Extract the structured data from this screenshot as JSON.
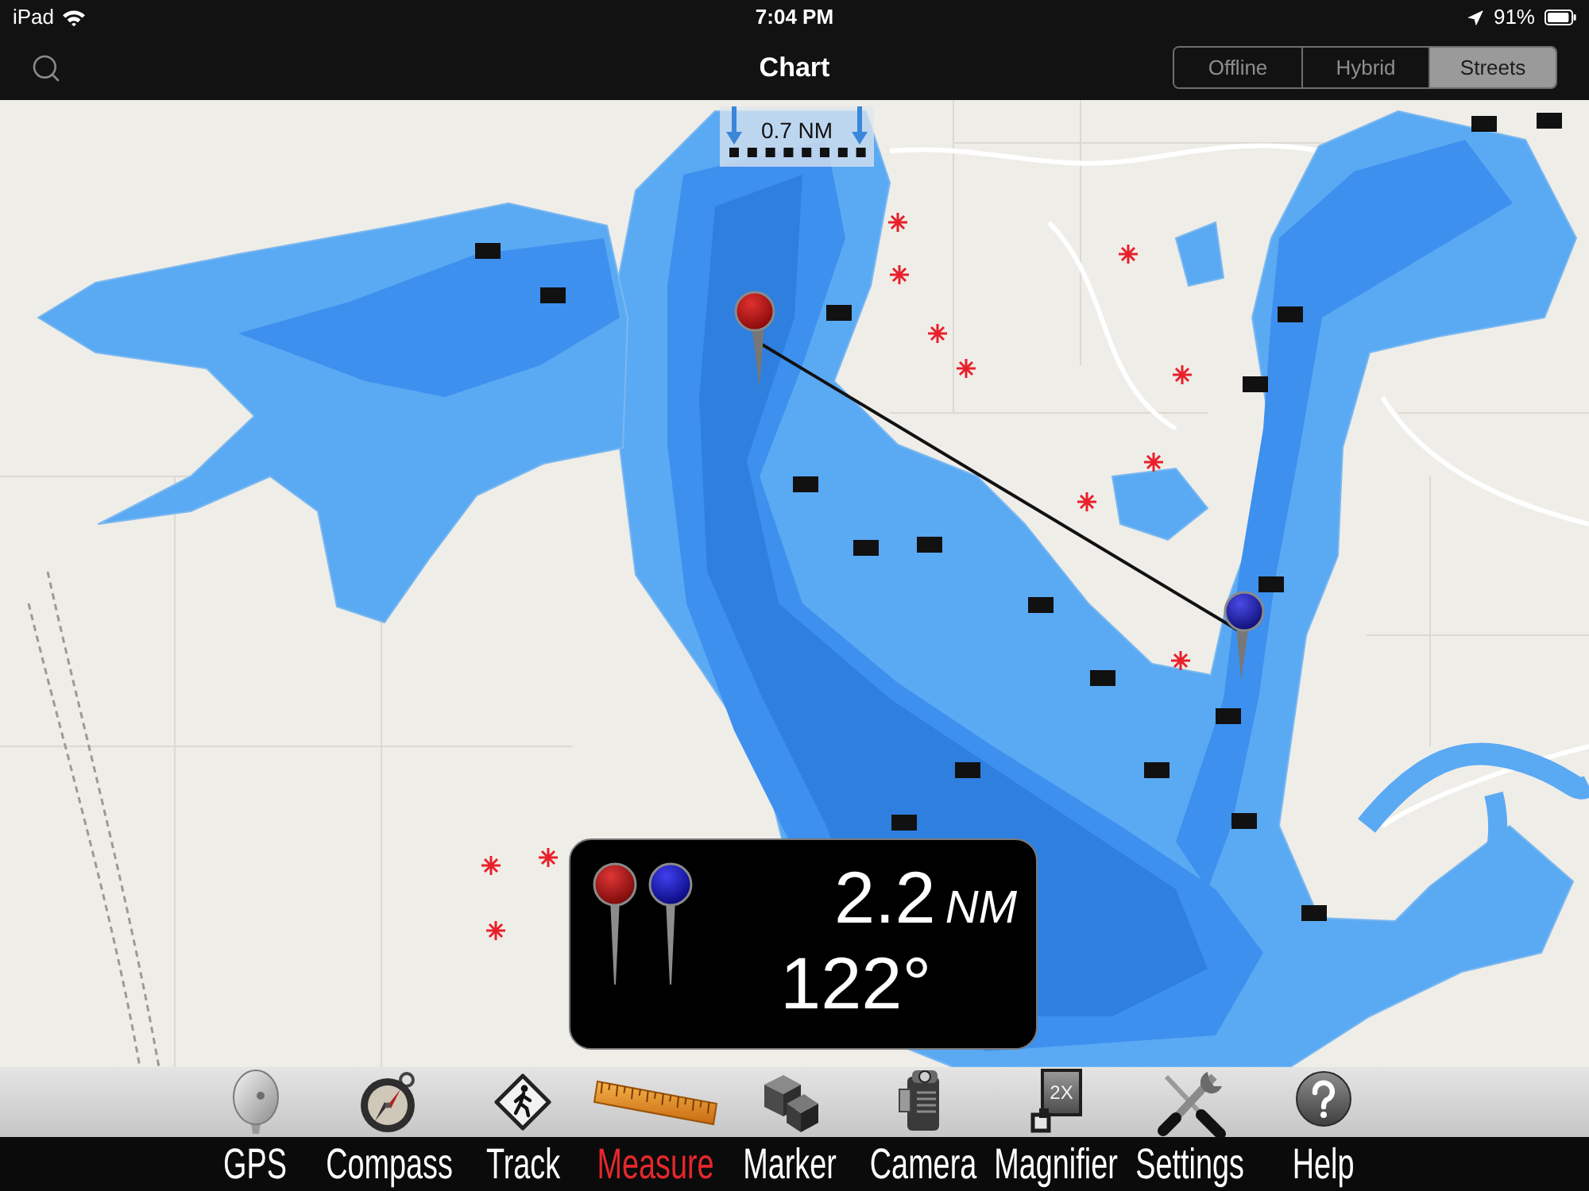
{
  "status_bar": {
    "device": "iPad",
    "time": "7:04 PM",
    "battery": "91%"
  },
  "nav_bar": {
    "title": "Chart",
    "map_modes": [
      {
        "label": "Offline",
        "selected": false
      },
      {
        "label": "Hybrid",
        "selected": false
      },
      {
        "label": "Streets",
        "selected": true
      }
    ]
  },
  "map": {
    "scale": "0.7 NM",
    "measurement": {
      "distance": "2.2",
      "unit": "NM",
      "bearing": "122°"
    }
  },
  "toolbar": [
    {
      "kind": "gps",
      "label": "GPS",
      "selected": false
    },
    {
      "kind": "compass",
      "label": "Compass",
      "selected": false
    },
    {
      "kind": "track",
      "label": "Track",
      "selected": false
    },
    {
      "kind": "measure",
      "label": "Measure",
      "selected": true
    },
    {
      "kind": "marker",
      "label": "Marker",
      "selected": false
    },
    {
      "kind": "camera",
      "label": "Camera",
      "selected": false
    },
    {
      "kind": "magnifier",
      "label": "Magnifier",
      "selected": false,
      "badge": "2X"
    },
    {
      "kind": "settings",
      "label": "Settings",
      "selected": false
    },
    {
      "kind": "help",
      "label": "Help",
      "selected": false
    }
  ]
}
